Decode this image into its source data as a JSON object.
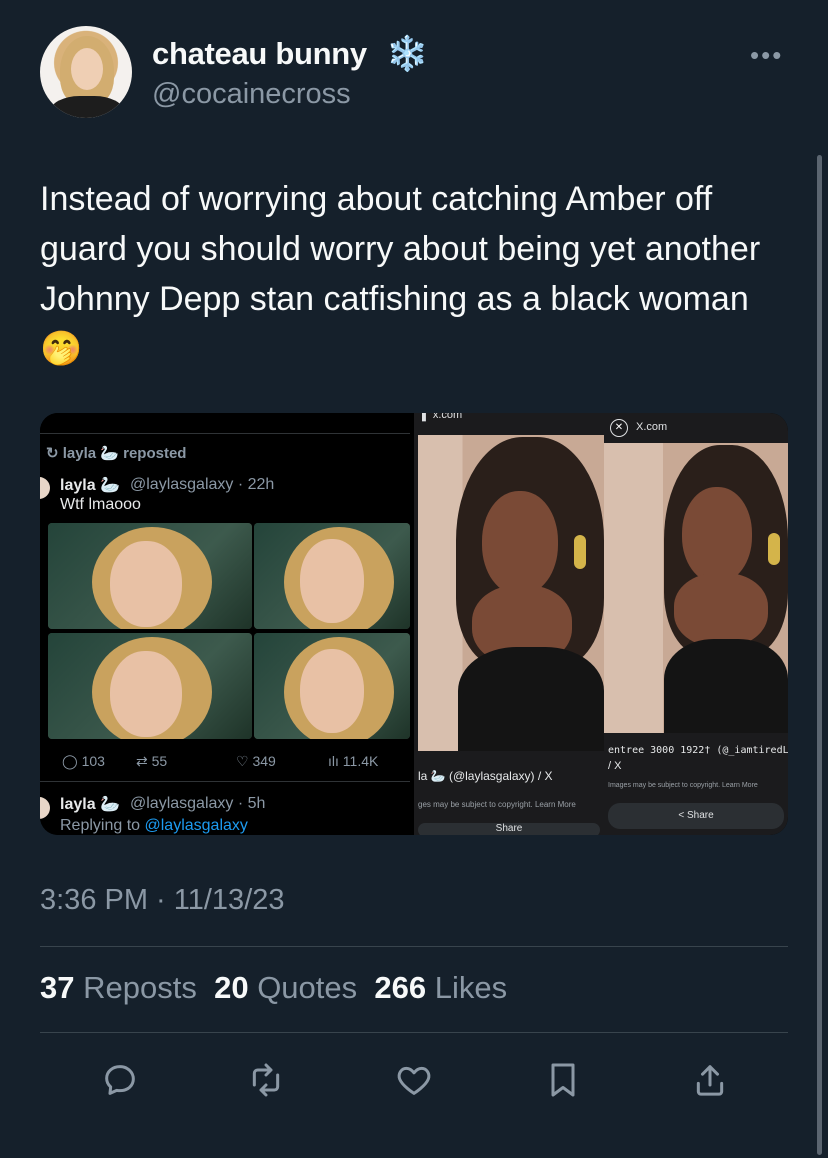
{
  "author": {
    "name": "chateau bunny",
    "name_emoji": "❄️",
    "handle": "@cocainecross"
  },
  "tweet": {
    "text": "Instead of worrying about catching Amber off guard you should worry about being yet another Johnny Depp stan catfishing as a black woman 🤭",
    "timestamp": "3:36 PM · 11/13/23"
  },
  "media": {
    "panel1": {
      "reposted": "layla 🦢 reposted",
      "post1": {
        "name": "layla 🦢",
        "handle": "@laylasgalaxy · 22h",
        "text": "Wtf lmaooo"
      },
      "stats": {
        "replies": "103",
        "reposts": "55",
        "likes": "349",
        "views": "11.4K"
      },
      "post2": {
        "name": "layla 🦢",
        "handle": "@laylasgalaxy · 5h",
        "reply_prefix": "Replying to ",
        "reply_handle": "@laylasgalaxy"
      }
    },
    "panel2": {
      "header": "x.com",
      "caption": "la 🦢 (@laylasgalaxy) / X",
      "copyright": "ges may be subject to copyright. Learn More",
      "share": "Share"
    },
    "panel3": {
      "header": "X.com",
      "caption1": "entree 3000 1922† (@_iamtiredL",
      "caption2": "/ X",
      "copyright": "Images may be subject to copyright. Learn More",
      "share": "< Share"
    }
  },
  "engagement": {
    "reposts_count": "37",
    "reposts_label": "Reposts",
    "quotes_count": "20",
    "quotes_label": "Quotes",
    "likes_count": "266",
    "likes_label": "Likes"
  },
  "actions": [
    "reply-icon",
    "repost-icon",
    "like-icon",
    "bookmark-icon",
    "share-icon"
  ],
  "colors": {
    "background": "#15202b",
    "text": "#f7f9f9",
    "muted": "#8b98a5",
    "link": "#1d9bf0"
  }
}
